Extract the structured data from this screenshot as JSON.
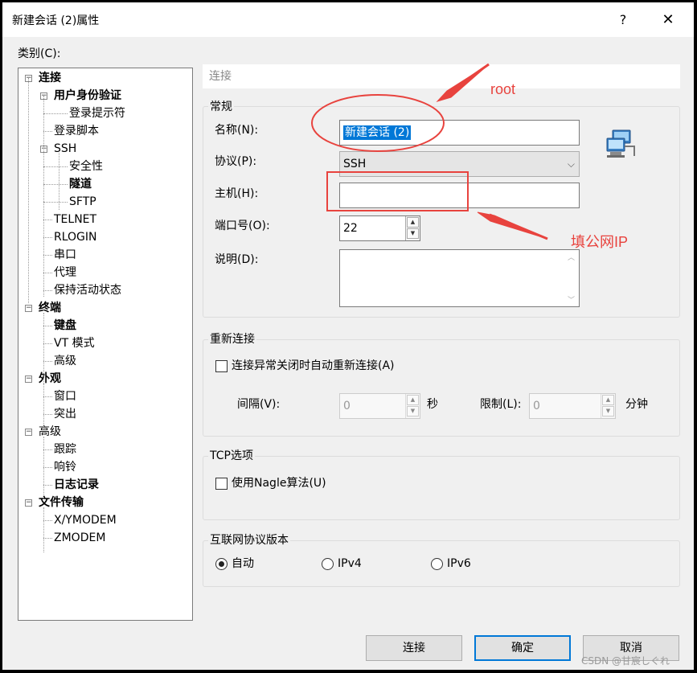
{
  "window": {
    "title": "新建会话 (2)属性",
    "help_glyph": "?",
    "close_glyph": "✕"
  },
  "category_label": "类别(C):",
  "tree": [
    {
      "label": "连接",
      "bold": true,
      "expander": "−"
    },
    {
      "label": "用户身份验证",
      "bold": true,
      "expander": "−"
    },
    {
      "label": "登录提示符",
      "bold": false
    },
    {
      "label": "登录脚本",
      "bold": false
    },
    {
      "label": "SSH",
      "bold": false,
      "expander": "−"
    },
    {
      "label": "安全性",
      "bold": false
    },
    {
      "label": "隧道",
      "bold": true
    },
    {
      "label": "SFTP",
      "bold": false
    },
    {
      "label": "TELNET",
      "bold": false
    },
    {
      "label": "RLOGIN",
      "bold": false
    },
    {
      "label": "串口",
      "bold": false
    },
    {
      "label": "代理",
      "bold": false
    },
    {
      "label": "保持活动状态",
      "bold": false
    },
    {
      "label": "终端",
      "bold": true,
      "expander": "−"
    },
    {
      "label": "键盘",
      "bold": true
    },
    {
      "label": "VT 模式",
      "bold": false
    },
    {
      "label": "高级",
      "bold": false
    },
    {
      "label": "外观",
      "bold": true,
      "expander": "−"
    },
    {
      "label": "窗口",
      "bold": false
    },
    {
      "label": "突出",
      "bold": false
    },
    {
      "label": "高级",
      "bold": false,
      "expander": "−"
    },
    {
      "label": "跟踪",
      "bold": false
    },
    {
      "label": "响铃",
      "bold": false
    },
    {
      "label": "日志记录",
      "bold": true
    },
    {
      "label": "文件传输",
      "bold": true,
      "expander": "−"
    },
    {
      "label": "X/YMODEM",
      "bold": false
    },
    {
      "label": "ZMODEM",
      "bold": false
    }
  ],
  "section_header": "连接",
  "general": {
    "group_label": "常规",
    "name_label": "名称(N):",
    "name_value": "新建会话 (2)",
    "protocol_label": "协议(P):",
    "protocol_value": "SSH",
    "host_label": "主机(H):",
    "host_value": "",
    "port_label": "端口号(O):",
    "port_value": "22",
    "desc_label": "说明(D):",
    "desc_value": ""
  },
  "reconnect": {
    "group_label": "重新连接",
    "checkbox_label": "连接异常关闭时自动重新连接(A)",
    "checked": false,
    "interval_label": "间隔(V):",
    "interval_value": "0",
    "interval_unit": "秒",
    "limit_label": "限制(L):",
    "limit_value": "0",
    "limit_unit": "分钟"
  },
  "tcp": {
    "group_label": "TCP选项",
    "nagle_label": "使用Nagle算法(U)",
    "checked": false
  },
  "ipver": {
    "group_label": "互联网协议版本",
    "options": [
      "自动",
      "IPv4",
      "IPv6"
    ],
    "selected": "自动"
  },
  "buttons": {
    "connect": "连接",
    "ok": "确定",
    "cancel": "取消"
  },
  "annotations": {
    "root": "root",
    "public_ip": "填公网IP"
  },
  "watermark": "CSDN @甘宸しぐれ",
  "colors": {
    "accent": "#0078d7",
    "annotation": "#e8433e"
  }
}
